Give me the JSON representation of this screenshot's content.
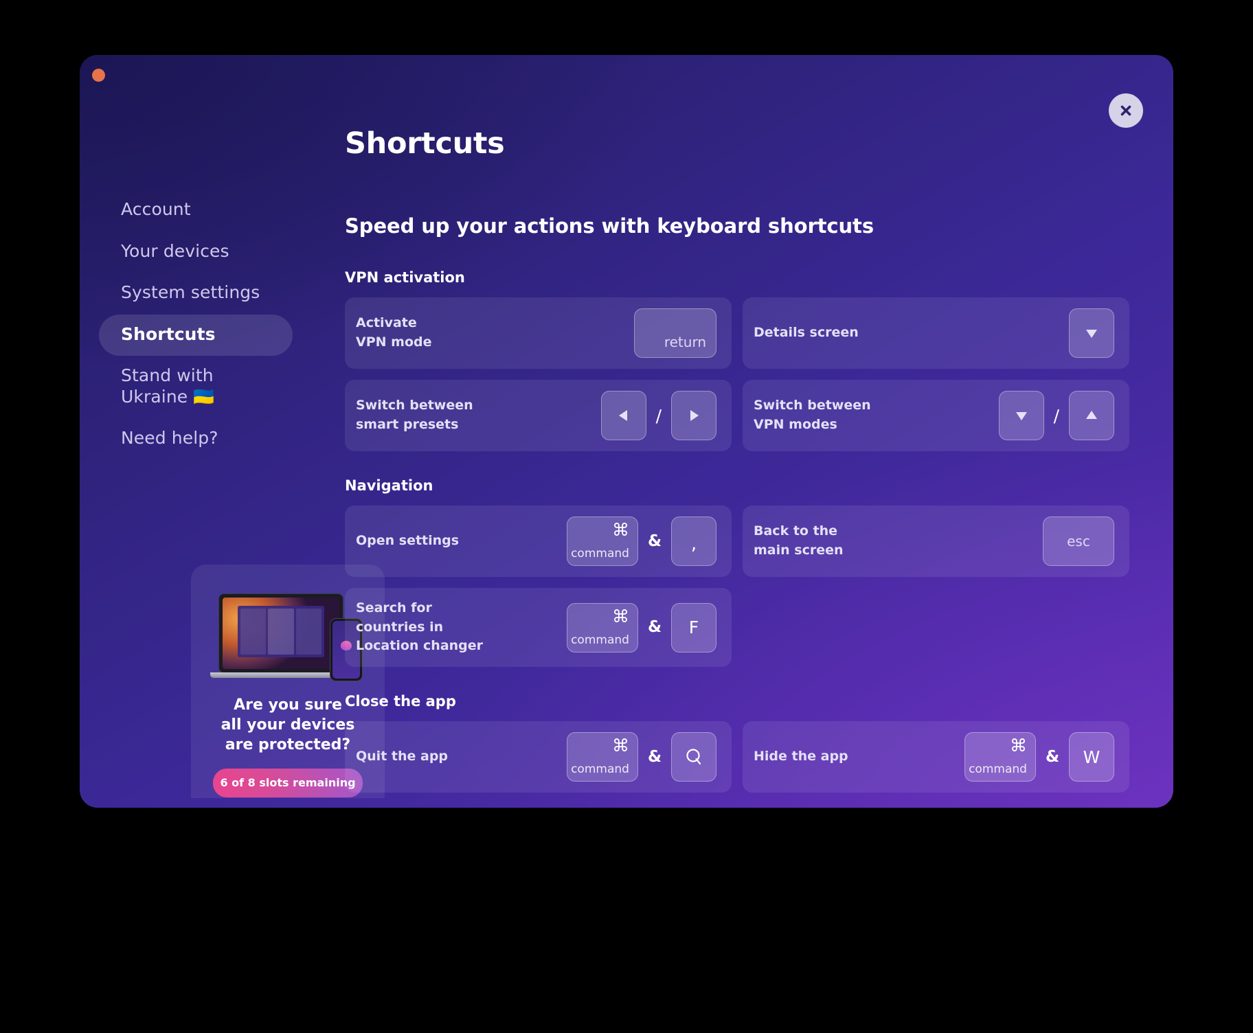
{
  "window": {
    "traffic_light_color": "#e8734a",
    "close_icon": "close-icon"
  },
  "sidebar": {
    "items": [
      {
        "label": "Account",
        "active": false
      },
      {
        "label": "Your devices",
        "active": false
      },
      {
        "label": "System settings",
        "active": false
      },
      {
        "label": "Shortcuts",
        "active": true
      },
      {
        "label": "Stand with\nUkraine 🇺🇦",
        "active": false
      },
      {
        "label": "Need help?",
        "active": false
      }
    ],
    "promo": {
      "headline": "Are you sure\nall your devices\nare protected?",
      "badge_label": "6 of 8 slots remaining",
      "badge_gradient_from": "#e8458f",
      "badge_gradient_to": "#a457c9"
    }
  },
  "main": {
    "title": "Shortcuts",
    "subtitle": "Speed up your actions with keyboard shortcuts",
    "sections": [
      {
        "title": "VPN activation",
        "cards": [
          {
            "label": "Activate\nVPN mode",
            "keys": [
              {
                "type": "wide",
                "text": "return"
              }
            ]
          },
          {
            "label": "Details screen",
            "keys": [
              {
                "type": "square",
                "icon": "arrow-down-icon"
              }
            ]
          },
          {
            "label": "Switch between\nsmart presets",
            "keys": [
              {
                "type": "square",
                "icon": "arrow-left-icon"
              },
              {
                "type": "sep",
                "text": "/"
              },
              {
                "type": "square",
                "icon": "arrow-right-icon"
              }
            ]
          },
          {
            "label": "Switch between\nVPN modes",
            "keys": [
              {
                "type": "square",
                "icon": "arrow-down-icon"
              },
              {
                "type": "sep",
                "text": "/"
              },
              {
                "type": "square",
                "icon": "arrow-up-icon"
              }
            ]
          }
        ]
      },
      {
        "title": "Navigation",
        "cards": [
          {
            "label": "Open settings",
            "keys": [
              {
                "type": "cmd",
                "glyph": "⌘",
                "text": "command"
              },
              {
                "type": "sep",
                "text": "&"
              },
              {
                "type": "square",
                "text": ","
              }
            ]
          },
          {
            "label": "Back to the\nmain screen",
            "keys": [
              {
                "type": "esc",
                "text": "esc"
              }
            ]
          },
          {
            "label": "Search for\ncountries in\nLocation changer",
            "keys": [
              {
                "type": "cmd",
                "glyph": "⌘",
                "text": "command"
              },
              {
                "type": "sep",
                "text": "&"
              },
              {
                "type": "square",
                "text": "F"
              }
            ]
          },
          {
            "empty": true
          }
        ]
      },
      {
        "title": "Close the app",
        "cards": [
          {
            "label": "Quit the app",
            "keys": [
              {
                "type": "cmd",
                "glyph": "⌘",
                "text": "command"
              },
              {
                "type": "sep",
                "text": "&"
              },
              {
                "type": "square",
                "icon": "letter-q-icon"
              }
            ]
          },
          {
            "label": "Hide the app",
            "keys": [
              {
                "type": "cmd",
                "glyph": "⌘",
                "text": "command"
              },
              {
                "type": "sep",
                "text": "&"
              },
              {
                "type": "square",
                "text": "W"
              }
            ]
          }
        ]
      }
    ]
  }
}
